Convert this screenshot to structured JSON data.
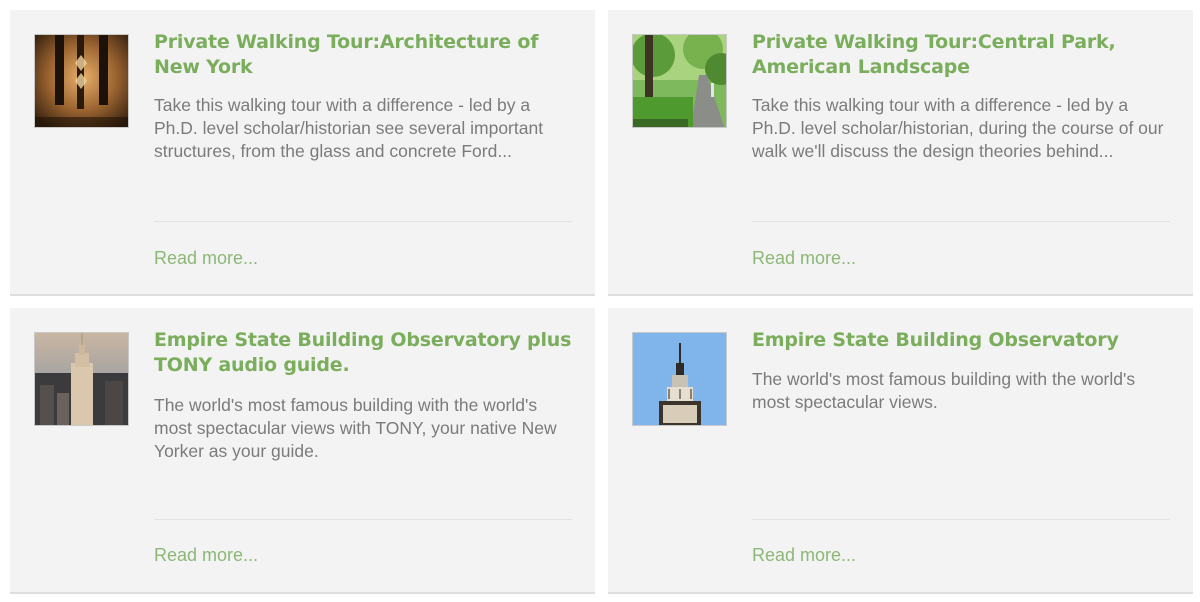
{
  "tours": [
    {
      "title": "Private Walking Tour:Architecture of New York",
      "description": "Take this walking tour with a difference - led by a Ph.D. level scholar/historian see several important structures, from the glass and concrete Ford...",
      "read_more": "Read more...",
      "image_icon": "architecture-photo"
    },
    {
      "title": "Private Walking Tour:Central Park, American Landscape",
      "description": "Take this walking tour with a difference - led by a Ph.D. level scholar/historian, during the course of our walk we'll discuss the design theories behind...",
      "read_more": "Read more...",
      "image_icon": "central-park-photo"
    },
    {
      "title": "Empire State Building Observatory plus TONY audio guide.",
      "description": "The world's most famous building with the world's most spectacular views with TONY, your native New Yorker as your guide.",
      "read_more": "Read more...",
      "image_icon": "skyline-photo"
    },
    {
      "title": "Empire State Building Observatory",
      "description": "The world's most famous building with the world's most spectacular views.",
      "read_more": "Read more...",
      "image_icon": "empire-state-photo"
    }
  ],
  "colors": {
    "title": "#7aad5c",
    "link": "#8cb777",
    "text": "#7b7b7b",
    "card_bg": "#f3f3f3"
  }
}
